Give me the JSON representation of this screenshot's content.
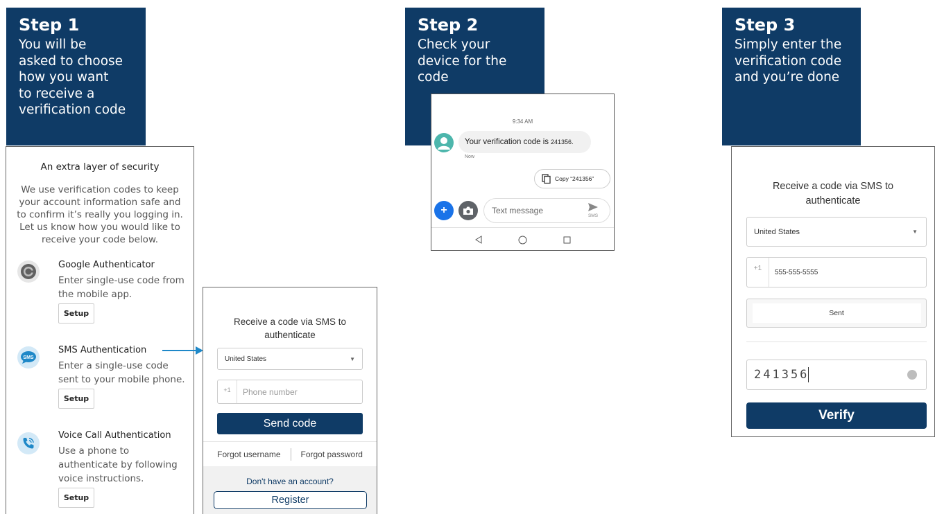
{
  "steps": [
    {
      "title": "Step 1",
      "lines": [
        "You will be",
        "asked to choose",
        "how you want",
        "to receive a",
        "verification code"
      ]
    },
    {
      "title": "Step 2",
      "lines": [
        "Check your",
        "device for the",
        "code"
      ]
    },
    {
      "title": "Step 3",
      "lines": [
        "Simply enter the",
        "verification code",
        "and you’re done"
      ]
    }
  ],
  "security": {
    "heading": "An extra layer of security",
    "intro": [
      "We use verification codes to keep",
      "your account information safe and",
      "to confirm it’s really you logging in.",
      "Let us know how you would like to",
      "receive your code below."
    ],
    "methods": [
      {
        "icon": "google-authenticator-icon",
        "title": "Google Authenticator",
        "desc": [
          "Enter single-use code from",
          "the mobile app."
        ],
        "button": "Setup"
      },
      {
        "icon": "sms-icon",
        "icon_text": "SMS",
        "title": "SMS Authentication",
        "desc": [
          "Enter a single-use code",
          "sent to your mobile phone."
        ],
        "button": "Setup"
      },
      {
        "icon": "phone-call-icon",
        "title": "Voice Call Authentication",
        "desc": [
          "Use a phone to",
          "authenticate by following",
          "voice instructions."
        ],
        "button": "Setup"
      }
    ]
  },
  "sms_form": {
    "title": [
      "Receive a code via SMS to",
      "authenticate"
    ],
    "country": "United States",
    "prefix": "+1",
    "phone_placeholder": "Phone number",
    "send_button": "Send code",
    "forgot_username": "Forgot username",
    "forgot_password": "Forgot password",
    "no_account": "Don't have an account?",
    "register_button": "Register"
  },
  "messages": {
    "time": "9:34 AM",
    "message_text": "Your verification code is",
    "message_code": "241356.",
    "message_age": "Now",
    "copy_label": "Copy “241356”",
    "input_placeholder": "Text message",
    "send_label": "SMS"
  },
  "verify_form": {
    "title": [
      "Receive a code via SMS to",
      "authenticate"
    ],
    "country": "United States",
    "prefix": "+1",
    "phone_value": "555-555-5555",
    "sent_button": "Sent",
    "code_value": "241356",
    "verify_button": "Verify"
  },
  "colors": {
    "brand_navy": "#0f3b66",
    "arrow_blue": "#1e88c8",
    "android_blue": "#1a73e8",
    "avatar_teal": "#4db6ac"
  }
}
